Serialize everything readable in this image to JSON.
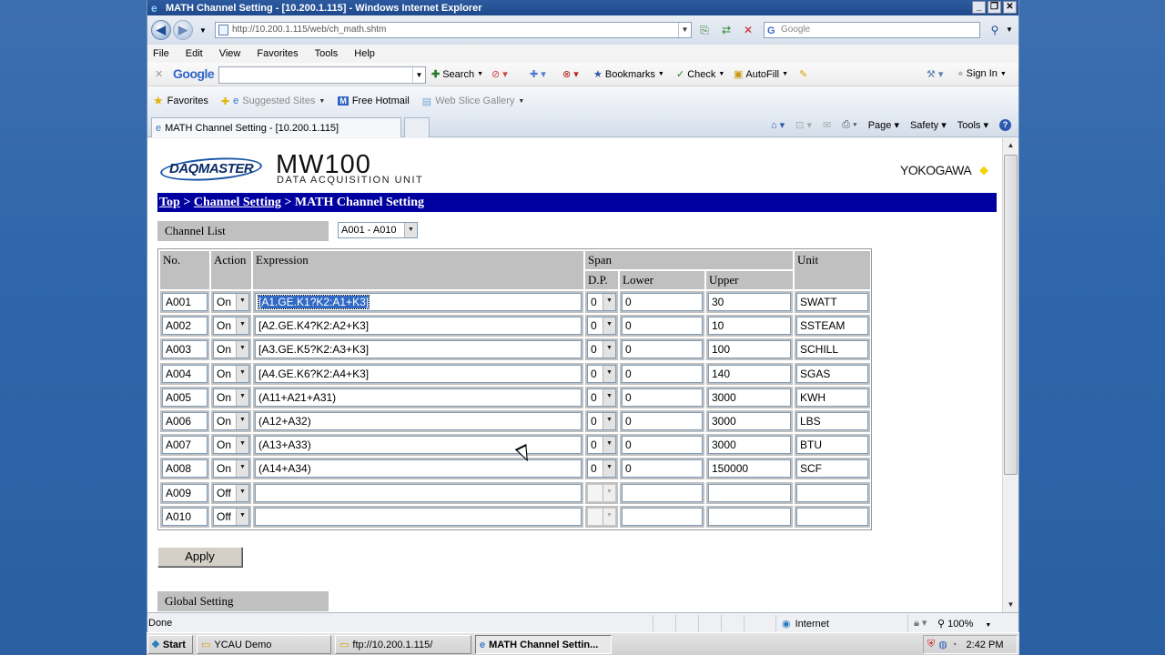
{
  "window": {
    "title": "MATH Channel Setting - [10.200.1.115] - Windows Internet Explorer",
    "minimize": "_",
    "maximize": "❐",
    "close": "✕"
  },
  "address": {
    "url": "http://10.200.1.115/web/ch_math.shtm",
    "search_placeholder": "Google"
  },
  "menu": [
    "File",
    "Edit",
    "View",
    "Favorites",
    "Tools",
    "Help"
  ],
  "google_toolbar": {
    "logo": "Google",
    "search": "Search",
    "bookmarks": "Bookmarks",
    "check": "Check",
    "autofill": "AutoFill",
    "sign_in": "Sign In"
  },
  "favorites_bar": {
    "favorites": "Favorites",
    "suggested": "Suggested Sites",
    "hotmail": "Free Hotmail",
    "webslice": "Web Slice Gallery"
  },
  "tab": {
    "title": "MATH Channel Setting - [10.200.1.115]"
  },
  "command_bar": [
    "Page",
    "Safety",
    "Tools"
  ],
  "page": {
    "daq_logo": "DAQMASTER",
    "product": "MW100",
    "product_sub": "DATA ACQUISITION UNIT",
    "brand": "YOKOGAWA",
    "breadcrumb": {
      "top": "Top",
      "sep": " > ",
      "channel": "Channel Setting",
      "current": "MATH Channel Setting"
    },
    "channel_list_label": "Channel List",
    "range_value": "A001 - A010",
    "columns": {
      "no": "No.",
      "action": "Action",
      "expression": "Expression",
      "span": "Span",
      "dp": "D.P.",
      "lower": "Lower",
      "upper": "Upper",
      "unit": "Unit"
    },
    "rows": [
      {
        "no": "A001",
        "action": "On",
        "expr": "[A1.GE.K1?K2:A1+K3]",
        "dp": "0",
        "lower": "0",
        "upper": "30",
        "unit": "SWATT"
      },
      {
        "no": "A002",
        "action": "On",
        "expr": "[A2.GE.K4?K2:A2+K3]",
        "dp": "0",
        "lower": "0",
        "upper": "10",
        "unit": "SSTEAM"
      },
      {
        "no": "A003",
        "action": "On",
        "expr": "[A3.GE.K5?K2:A3+K3]",
        "dp": "0",
        "lower": "0",
        "upper": "100",
        "unit": "SCHILL"
      },
      {
        "no": "A004",
        "action": "On",
        "expr": "[A4.GE.K6?K2:A4+K3]",
        "dp": "0",
        "lower": "0",
        "upper": "140",
        "unit": "SGAS"
      },
      {
        "no": "A005",
        "action": "On",
        "expr": "(A11+A21+A31)",
        "dp": "0",
        "lower": "0",
        "upper": "3000",
        "unit": "KWH"
      },
      {
        "no": "A006",
        "action": "On",
        "expr": "(A12+A32)",
        "dp": "0",
        "lower": "0",
        "upper": "3000",
        "unit": "LBS"
      },
      {
        "no": "A007",
        "action": "On",
        "expr": "(A13+A33)",
        "dp": "0",
        "lower": "0",
        "upper": "3000",
        "unit": "BTU"
      },
      {
        "no": "A008",
        "action": "On",
        "expr": "(A14+A34)",
        "dp": "0",
        "lower": "0",
        "upper": "150000",
        "unit": "SCF"
      },
      {
        "no": "A009",
        "action": "Off",
        "expr": "",
        "dp": "",
        "lower": "",
        "upper": "",
        "unit": ""
      },
      {
        "no": "A010",
        "action": "Off",
        "expr": "",
        "dp": "",
        "lower": "",
        "upper": "",
        "unit": ""
      }
    ],
    "apply": "Apply",
    "global_setting": "Global Setting"
  },
  "status": {
    "text": "Done",
    "zone": "Internet",
    "zoom": "100%"
  },
  "taskbar": {
    "start": "Start",
    "items": [
      "YCAU Demo",
      "ftp://10.200.1.115/",
      "MATH Channel Settin..."
    ],
    "clock": "2:42 PM"
  }
}
